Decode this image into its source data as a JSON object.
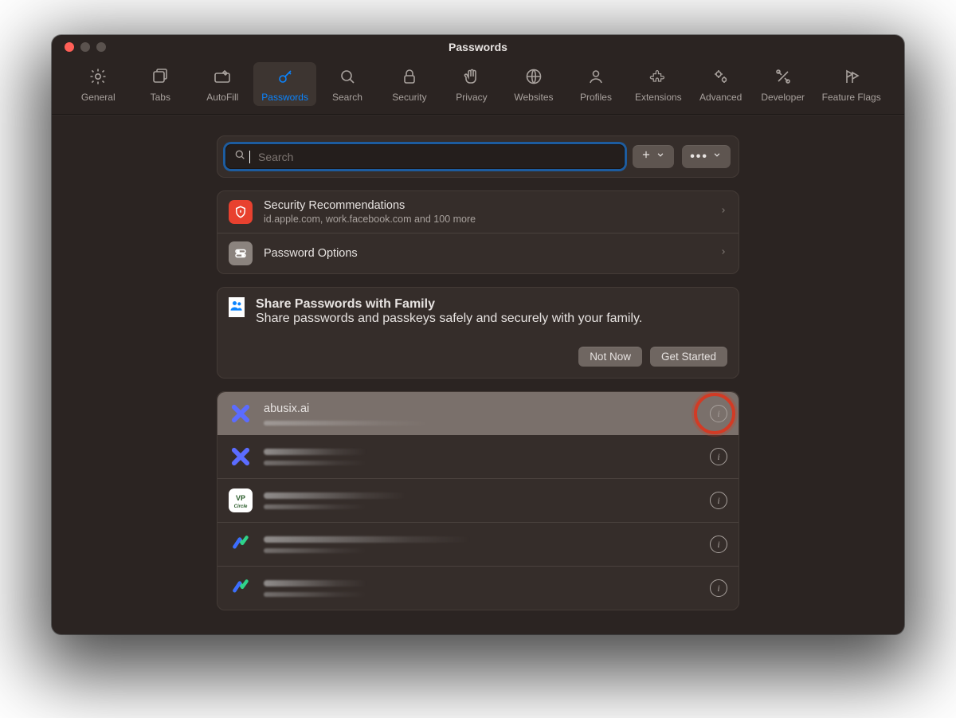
{
  "window": {
    "title": "Passwords"
  },
  "toolbar": {
    "items": [
      {
        "label": "General"
      },
      {
        "label": "Tabs"
      },
      {
        "label": "AutoFill"
      },
      {
        "label": "Passwords"
      },
      {
        "label": "Search"
      },
      {
        "label": "Security"
      },
      {
        "label": "Privacy"
      },
      {
        "label": "Websites"
      },
      {
        "label": "Profiles"
      },
      {
        "label": "Extensions"
      },
      {
        "label": "Advanced"
      },
      {
        "label": "Developer"
      },
      {
        "label": "Feature Flags"
      }
    ],
    "active_index": 3
  },
  "search": {
    "placeholder": "Search",
    "value": ""
  },
  "recommendations": {
    "title": "Security Recommendations",
    "subtitle": "id.apple.com, work.facebook.com and 100 more"
  },
  "password_options": {
    "title": "Password Options"
  },
  "share": {
    "title": "Share Passwords with Family",
    "subtitle": "Share passwords and passkeys safely and securely with your family.",
    "not_now": "Not Now",
    "get_started": "Get Started"
  },
  "entries": [
    {
      "site": "abusix.ai",
      "selected": true,
      "highlighted_info": true,
      "icon": "x-blue"
    },
    {
      "site": "",
      "selected": false,
      "icon": "x-blue"
    },
    {
      "site": "",
      "selected": false,
      "icon": "vp"
    },
    {
      "site": "",
      "selected": false,
      "icon": "arrow"
    },
    {
      "site": "",
      "selected": false,
      "icon": "arrow"
    }
  ]
}
